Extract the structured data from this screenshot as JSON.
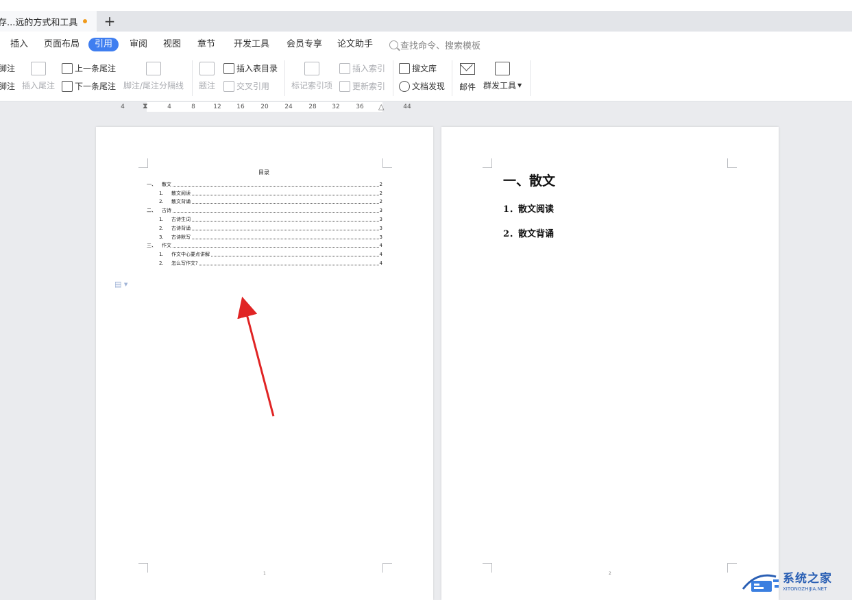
{
  "tab": {
    "title": "存...远的方式和工具",
    "new_tab": "+"
  },
  "menu": {
    "items": [
      "插入",
      "页面布局",
      "引用",
      "审阅",
      "视图",
      "章节",
      "开发工具",
      "会员专享",
      "论文助手"
    ],
    "active": "引用",
    "search_placeholder": "查找命令、搜索模板"
  },
  "ribbon": {
    "footnote_top": "脚注",
    "footnote_bottom": "脚注",
    "insert_endnote": "插入尾注",
    "prev_endnote": "上一条尾注",
    "next_endnote": "下一条尾注",
    "note_separator": "脚注/尾注分隔线",
    "caption": "题注",
    "insert_toc_table": "插入表目录",
    "cross_ref": "交叉引用",
    "mark_index": "标记索引项",
    "insert_index": "插入索引",
    "update_index": "更新索引",
    "search_library": "搜文库",
    "doc_discover": "文档发现",
    "mail": "邮件",
    "mass_send": "群发工具"
  },
  "ruler": {
    "ticks": [
      "4",
      "4",
      "8",
      "12",
      "16",
      "20",
      "24",
      "28",
      "32",
      "36",
      "44"
    ]
  },
  "toc": {
    "title": "目录",
    "entries": [
      {
        "num": "一、",
        "text": "散文",
        "page": "2",
        "level": 1
      },
      {
        "num": "1.",
        "text": "散文阅读",
        "page": "2",
        "level": 2
      },
      {
        "num": "2.",
        "text": "散文背诵",
        "page": "2",
        "level": 2
      },
      {
        "num": "二、",
        "text": "古诗",
        "page": "3",
        "level": 1
      },
      {
        "num": "1.",
        "text": "古诗生词",
        "page": "3",
        "level": 2
      },
      {
        "num": "2.",
        "text": "古诗背诵",
        "page": "3",
        "level": 2
      },
      {
        "num": "3.",
        "text": "古诗默写",
        "page": "3",
        "level": 2
      },
      {
        "num": "三、",
        "text": "作文",
        "page": "4",
        "level": 1
      },
      {
        "num": "1.",
        "text": "作文中心要点讲解",
        "page": "4",
        "level": 2
      },
      {
        "num": "2.",
        "text": "怎么写作文?",
        "page": "4",
        "level": 2
      }
    ],
    "page_number": "1"
  },
  "right_page": {
    "heading1": "一、散文",
    "heading2a": "1．散文阅读",
    "heading2b": "2．散文背诵",
    "page_number": "2"
  },
  "watermark": {
    "cn": "系统之家",
    "en": "XITONGZHIJIA.NET"
  },
  "colors": {
    "accent": "#3f7ef0",
    "arrow": "#e02424",
    "unsaved": "#f09a1a"
  }
}
